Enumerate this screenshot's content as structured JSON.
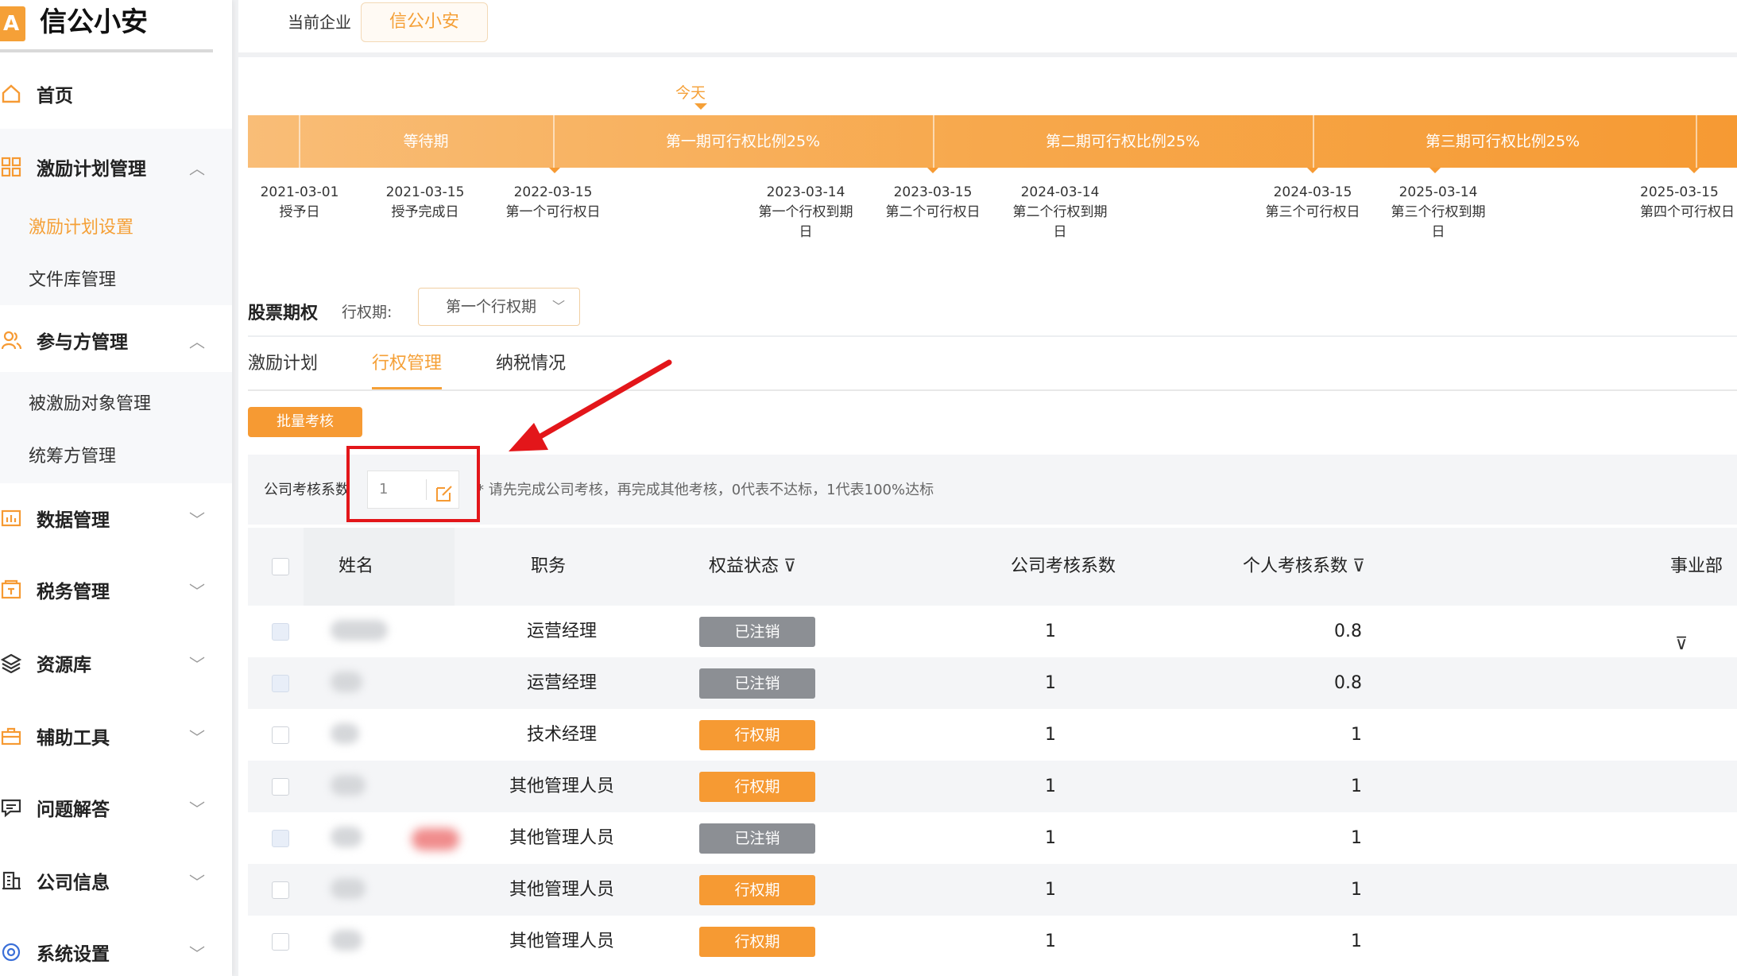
{
  "brand": {
    "logo_letter": "A",
    "name": "信公小安"
  },
  "sidebar": {
    "home": "首页",
    "incentive_plan": {
      "label": "激励计划管理",
      "children": [
        "激励计划设置",
        "文件库管理"
      ]
    },
    "participants": {
      "label": "参与方管理",
      "children": [
        "被激励对象管理",
        "统筹方管理"
      ]
    },
    "sections": [
      "数据管理",
      "税务管理",
      "资源库",
      "辅助工具",
      "问题解答",
      "公司信息",
      "系统设置"
    ]
  },
  "header": {
    "company_label": "当前企业",
    "company_name": "信公小安"
  },
  "timeline": {
    "today": "今天",
    "periods": [
      "等待期",
      "第一期可行权比例25%",
      "第二期可行权比例25%",
      "第三期可行权比例25%"
    ],
    "milestones": [
      {
        "date": "2021-03-01",
        "label": "授予日"
      },
      {
        "date": "2021-03-15",
        "label": "授予完成日"
      },
      {
        "date": "2022-03-15",
        "label": "第一个可行权日"
      },
      {
        "date": "2023-03-14",
        "label": "第一个行权到期日"
      },
      {
        "date": "2023-03-15",
        "label": "第二个可行权日"
      },
      {
        "date": "2024-03-14",
        "label": "第二个行权到期日"
      },
      {
        "date": "2024-03-15",
        "label": "第三个可行权日"
      },
      {
        "date": "2025-03-14",
        "label": "第三个行权到期日"
      },
      {
        "date": "2025-03-15",
        "label": "第四个可行权日"
      }
    ]
  },
  "options": {
    "title": "股票期权",
    "period_label": "行权期:",
    "period_value": "第一个行权期"
  },
  "tabs": [
    "激励计划",
    "行权管理",
    "纳税情况"
  ],
  "batch_button": "批量考核",
  "company_coef": {
    "label": "公司考核系数",
    "value": "1",
    "hint": "* 请先完成公司考核，再完成其他考核，0代表不达标，1代表100%达标"
  },
  "table": {
    "headers": [
      "姓名",
      "职务",
      "权益状态",
      "公司考核系数",
      "个人考核系数",
      "事业部"
    ],
    "rows": [
      {
        "position": "运营经理",
        "status": "已注销",
        "status_type": "cancel",
        "company_coef": "1",
        "personal_coef": "0.8",
        "disabled": true
      },
      {
        "position": "运营经理",
        "status": "已注销",
        "status_type": "cancel",
        "company_coef": "1",
        "personal_coef": "0.8",
        "disabled": true
      },
      {
        "position": "技术经理",
        "status": "行权期",
        "status_type": "active",
        "company_coef": "1",
        "personal_coef": "1",
        "disabled": false
      },
      {
        "position": "其他管理人员",
        "status": "行权期",
        "status_type": "active",
        "company_coef": "1",
        "personal_coef": "1",
        "disabled": false
      },
      {
        "position": "其他管理人员",
        "status": "已注销",
        "status_type": "cancel",
        "company_coef": "1",
        "personal_coef": "1",
        "disabled": true
      },
      {
        "position": "其他管理人员",
        "status": "行权期",
        "status_type": "active",
        "company_coef": "1",
        "personal_coef": "1",
        "disabled": false
      },
      {
        "position": "其他管理人员",
        "status": "行权期",
        "status_type": "active",
        "company_coef": "1",
        "personal_coef": "1",
        "disabled": false
      }
    ]
  },
  "colors": {
    "accent": "#f69a33",
    "annotation": "#e3161a",
    "cancel": "#8c8f94"
  }
}
